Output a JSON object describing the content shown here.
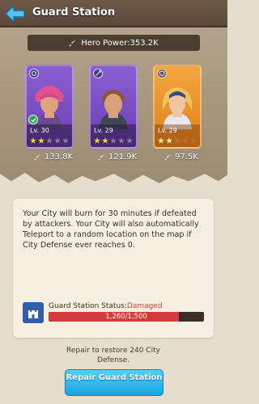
{
  "header": {
    "title": "Guard Station"
  },
  "hero_power": {
    "label": "Hero Power:353.2K"
  },
  "heroes": [
    {
      "level": "Lv. 30",
      "stars_filled": 2,
      "stars_total": 5,
      "power": "133.8K"
    },
    {
      "level": "Lv. 29",
      "stars_filled": 2,
      "stars_total": 5,
      "power": "121.9K"
    },
    {
      "level": "Lv. 29",
      "stars_filled": 2,
      "stars_total": 5,
      "power": "97.5K"
    }
  ],
  "info": {
    "description": "Your City will burn for 30 minutes if defeated by attackers. Your City will also automatically Teleport to a random location on the map if City Defense ever reaches 0.",
    "status_label": "Guard Station Status:",
    "status_value": "Damaged",
    "defense_text": "1,260/1,500",
    "defense_current": 1260,
    "defense_max": 1500
  },
  "repair": {
    "note": "Repair to restore 240 City Defense.",
    "button_label": "Repair Guard Station"
  },
  "colors": {
    "damaged": "#d63b3b",
    "button": "#1ea2e0",
    "epic_card": "#6a3fb4",
    "legendary_card": "#e07f1d"
  }
}
